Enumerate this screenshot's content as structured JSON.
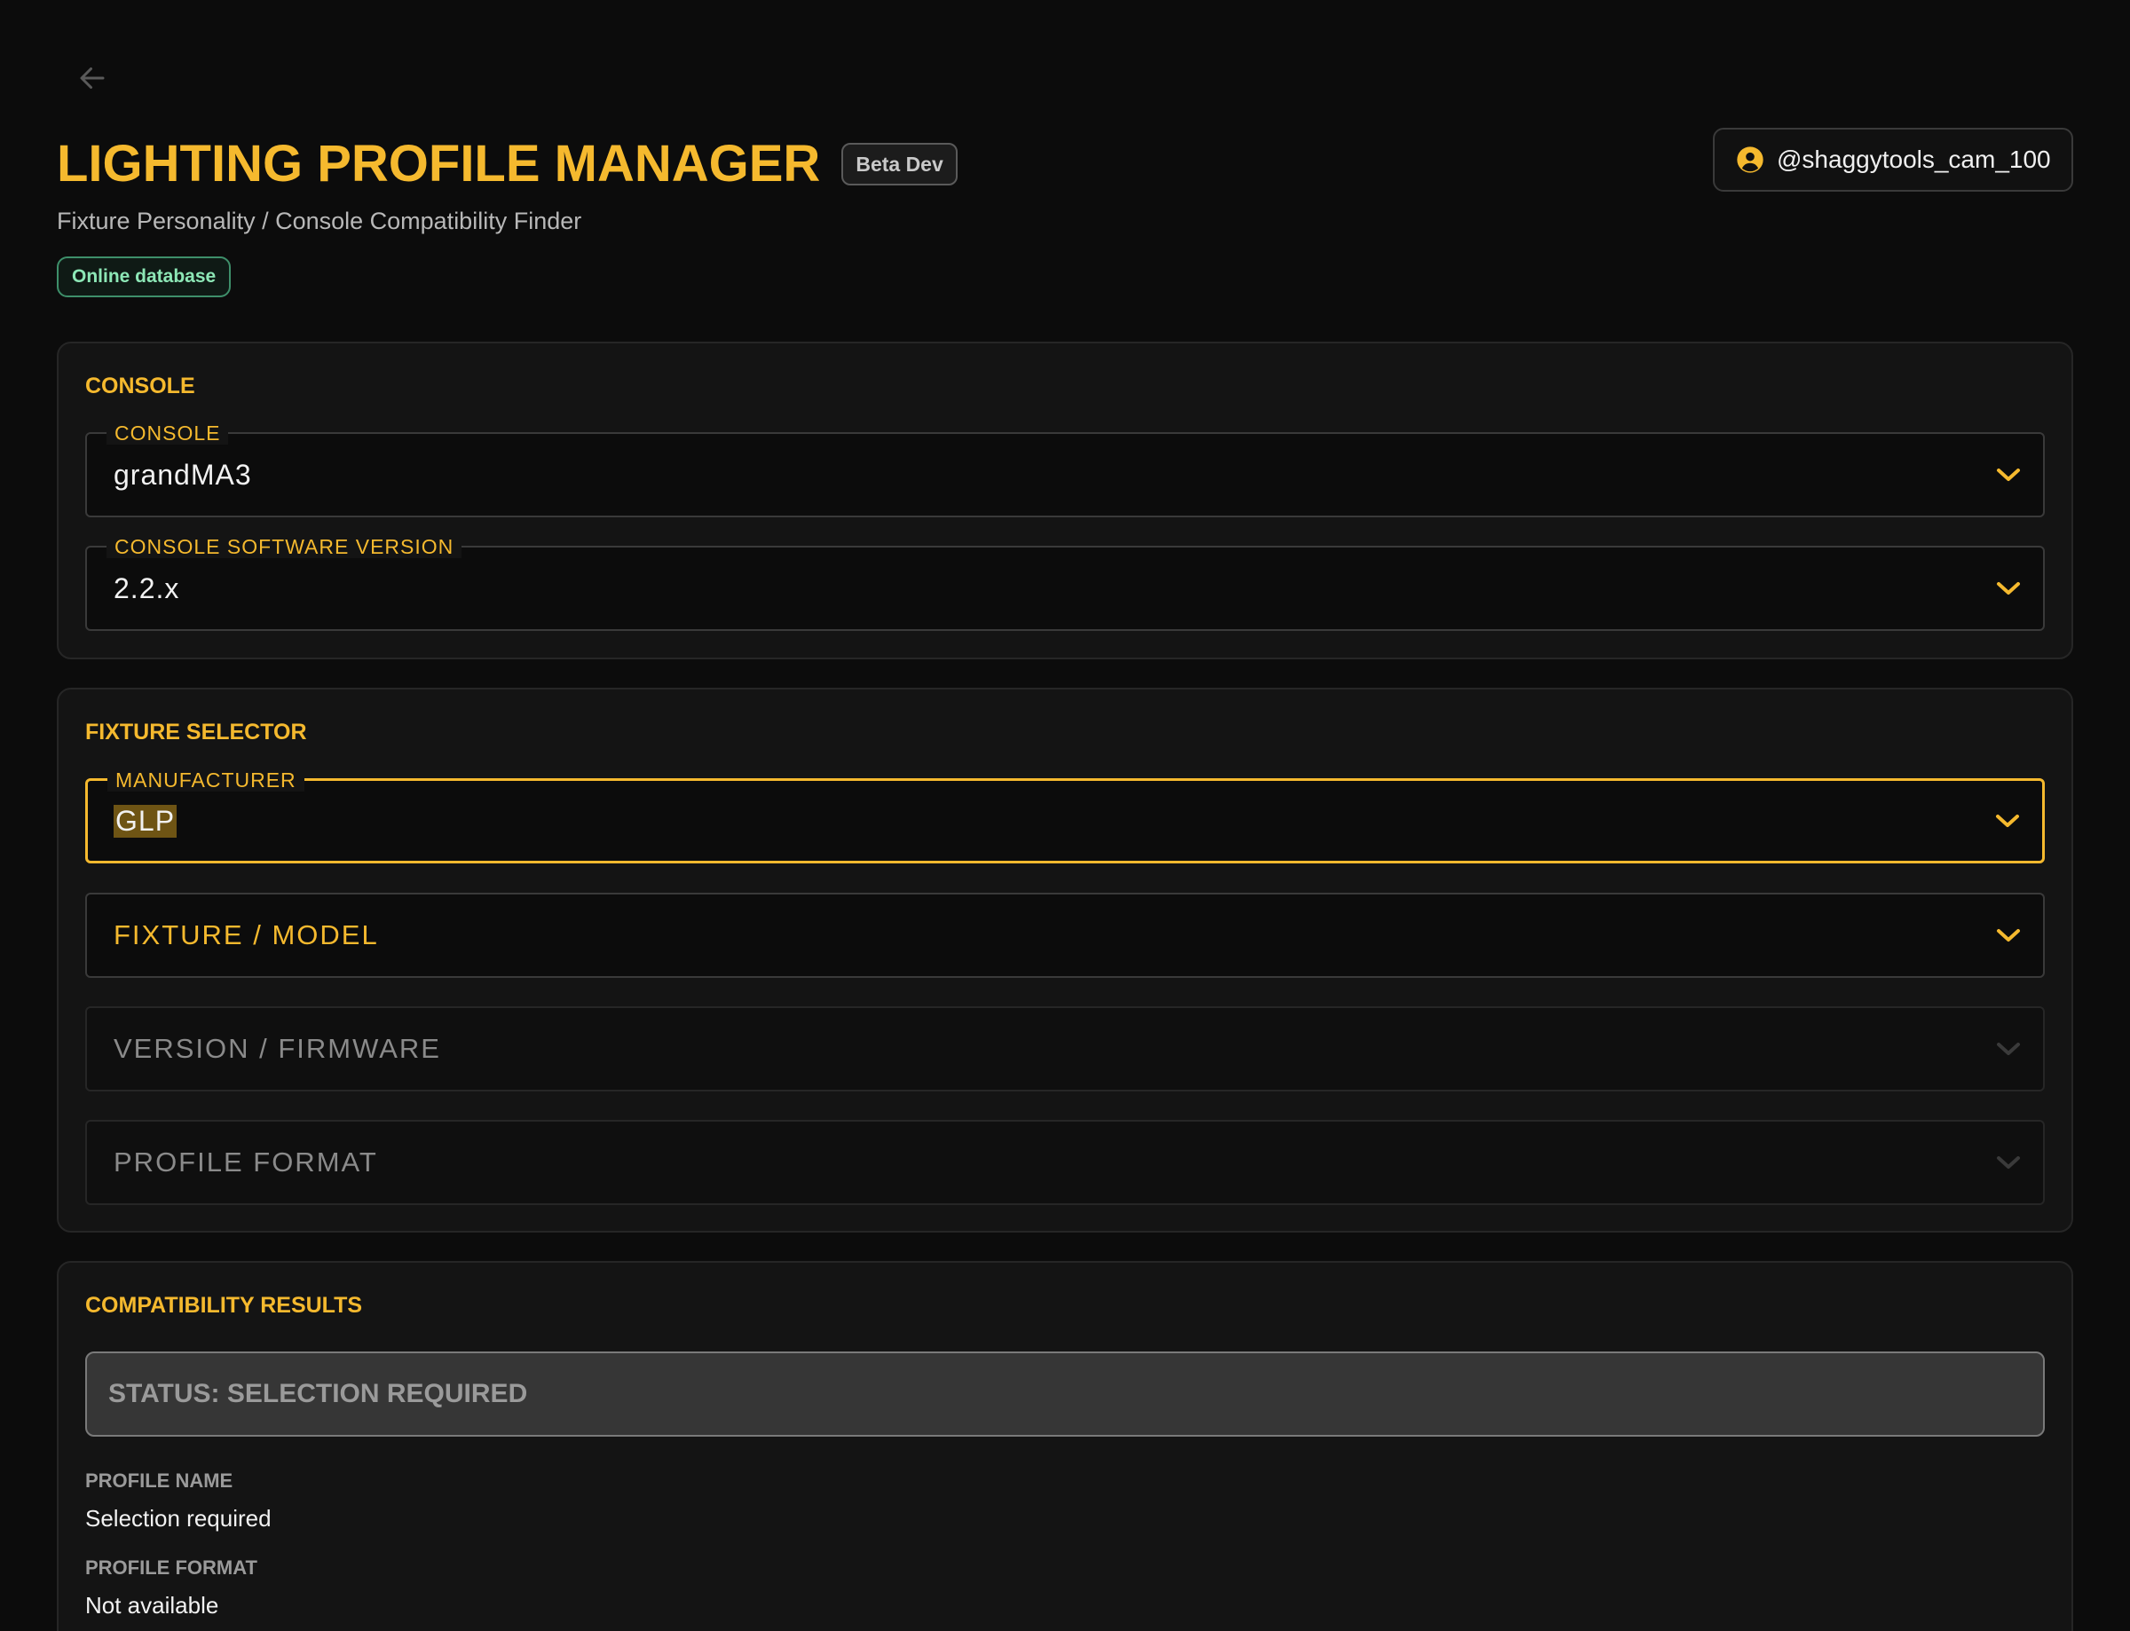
{
  "header": {
    "title": "LIGHTING PROFILE MANAGER",
    "badge": "Beta Dev",
    "subtitle": "Fixture Personality / Console Compatibility Finder",
    "db_status": "Online database",
    "user": "@shaggytools_cam_100"
  },
  "console_panel": {
    "title": "CONSOLE",
    "console": {
      "label": "CONSOLE",
      "value": "grandMA3"
    },
    "software_version": {
      "label": "CONSOLE SOFTWARE VERSION",
      "value": "2.2.x"
    }
  },
  "fixture_panel": {
    "title": "FIXTURE SELECTOR",
    "manufacturer": {
      "label": "MANUFACTURER",
      "value": "GLP"
    },
    "model": {
      "placeholder": "FIXTURE / MODEL"
    },
    "firmware": {
      "placeholder": "VERSION / FIRMWARE",
      "disabled": true
    },
    "profile_format": {
      "placeholder": "PROFILE FORMAT",
      "disabled": true
    }
  },
  "results_panel": {
    "title": "COMPATIBILITY RESULTS",
    "status": "STATUS: SELECTION REQUIRED",
    "profile_name_label": "PROFILE NAME",
    "profile_name_value": "Selection required",
    "profile_format_label": "PROFILE FORMAT",
    "profile_format_value": "Not available"
  },
  "colors": {
    "accent": "#f5b92e",
    "background": "#0c0c0c",
    "panel": "#141414",
    "online": "#8de7b6"
  },
  "icons": {
    "back": "arrow-left-icon",
    "user": "user-circle-icon",
    "dropdown": "chevron-down-icon"
  }
}
